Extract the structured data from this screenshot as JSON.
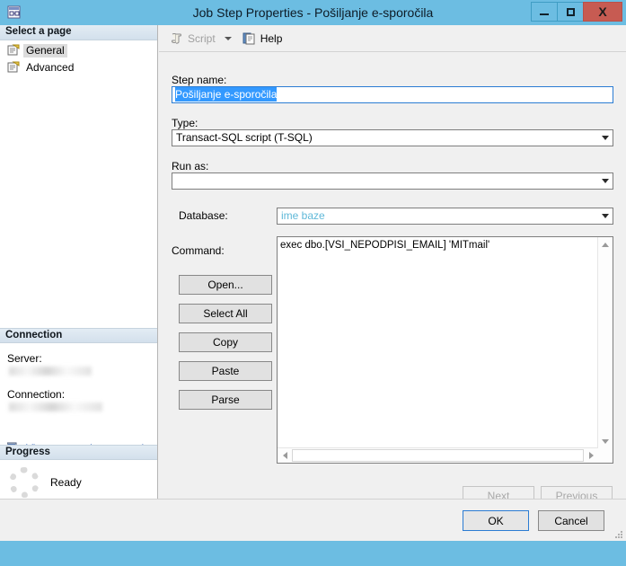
{
  "window": {
    "title": "Job Step Properties - Pošiljanje e-sporočila",
    "app_icon": "job-step-icon",
    "minimize_label": "–",
    "maximize_label": "□",
    "close_label": "X"
  },
  "toolbar": {
    "script_label": "Script",
    "script_icon": "script-scroll-icon",
    "help_label": "Help",
    "help_icon": "help-book-icon",
    "dropdown_icon": "chevron-down-icon"
  },
  "sidebar": {
    "select_page_header": "Select a page",
    "items": [
      {
        "label": "General",
        "icon": "page-icon",
        "selected": true
      },
      {
        "label": "Advanced",
        "icon": "page-icon",
        "selected": false
      }
    ],
    "connection_header": "Connection",
    "server_label": "Server:",
    "server_value": "",
    "connection_label": "Connection:",
    "connection_value": "",
    "view_connection_link": "View connection properties",
    "view_connection_icon": "network-connection-icon",
    "progress_header": "Progress",
    "progress_icon": "spinner-icon",
    "progress_status": "Ready"
  },
  "form": {
    "step_name_label": "Step name:",
    "step_name_value": "Pošiljanje e-sporočila",
    "type_label": "Type:",
    "type_value": "Transact-SQL script (T-SQL)",
    "run_as_label": "Run as:",
    "run_as_value": "",
    "database_label": "Database:",
    "database_value": "ime baze",
    "command_label": "Command:",
    "command_value": "exec dbo.[VSI_NEPODPISI_EMAIL] 'MITmail'"
  },
  "command_buttons": {
    "open": "Open...",
    "select_all": "Select All",
    "copy": "Copy",
    "paste": "Paste",
    "parse": "Parse"
  },
  "navigation": {
    "next": "Next",
    "previous": "Previous"
  },
  "footer": {
    "ok": "OK",
    "cancel": "Cancel"
  },
  "colors": {
    "titlebar": "#6cbde2",
    "close_button": "#c75b52",
    "selection": "#3399ff",
    "link": "#0645ad",
    "database_value": "#5fb8d8",
    "dialog_bg": "#f0f0f0"
  }
}
